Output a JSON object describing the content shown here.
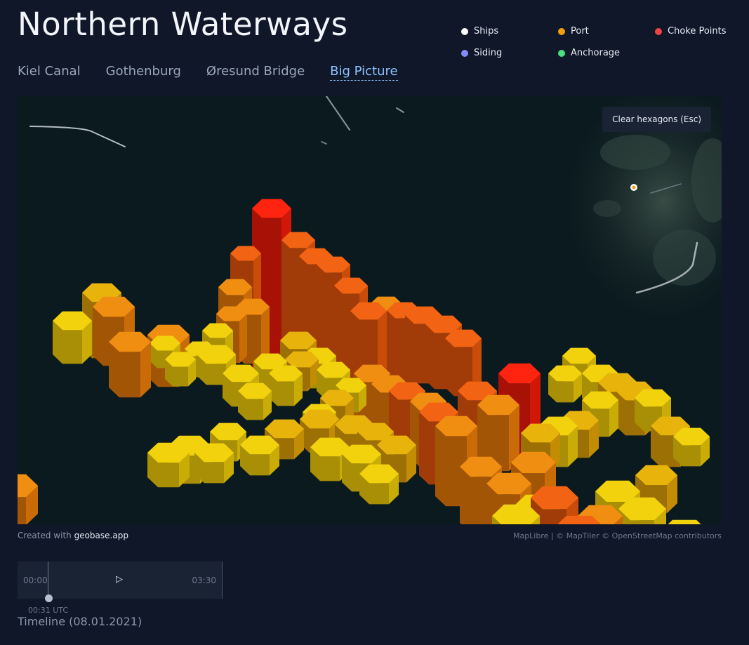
{
  "header": {
    "title": "Northern Waterways"
  },
  "tabs": [
    {
      "label": "Kiel Canal",
      "active": false
    },
    {
      "label": "Gothenburg",
      "active": false
    },
    {
      "label": "Øresund Bridge",
      "active": false
    },
    {
      "label": "Big Picture",
      "active": true
    }
  ],
  "legend": [
    {
      "label": "Ships",
      "color": "#ffffff"
    },
    {
      "label": "Port",
      "color": "#f59e0b"
    },
    {
      "label": "Choke Points",
      "color": "#ef4444"
    },
    {
      "label": "Siding",
      "color": "#818cf8"
    },
    {
      "label": "Anchorage",
      "color": "#4ade80"
    }
  ],
  "map": {
    "clear_button": "Clear hexagons (Esc)",
    "colors": {
      "water": "#0a1a1f",
      "low": "#e0c40a",
      "mid": "#f08a10",
      "high": "#ff2a10"
    }
  },
  "footer": {
    "credit_prefix": "Created with",
    "credit_link": "geobase.app",
    "attribution": "MapLibre | © MapTiler © OpenStreetMap contributors"
  },
  "timeline": {
    "start": "00:00",
    "end": "03:30",
    "play_icon": "play-icon",
    "current": "00:31 UTC",
    "label": "Timeline (08.01.2021)"
  }
}
